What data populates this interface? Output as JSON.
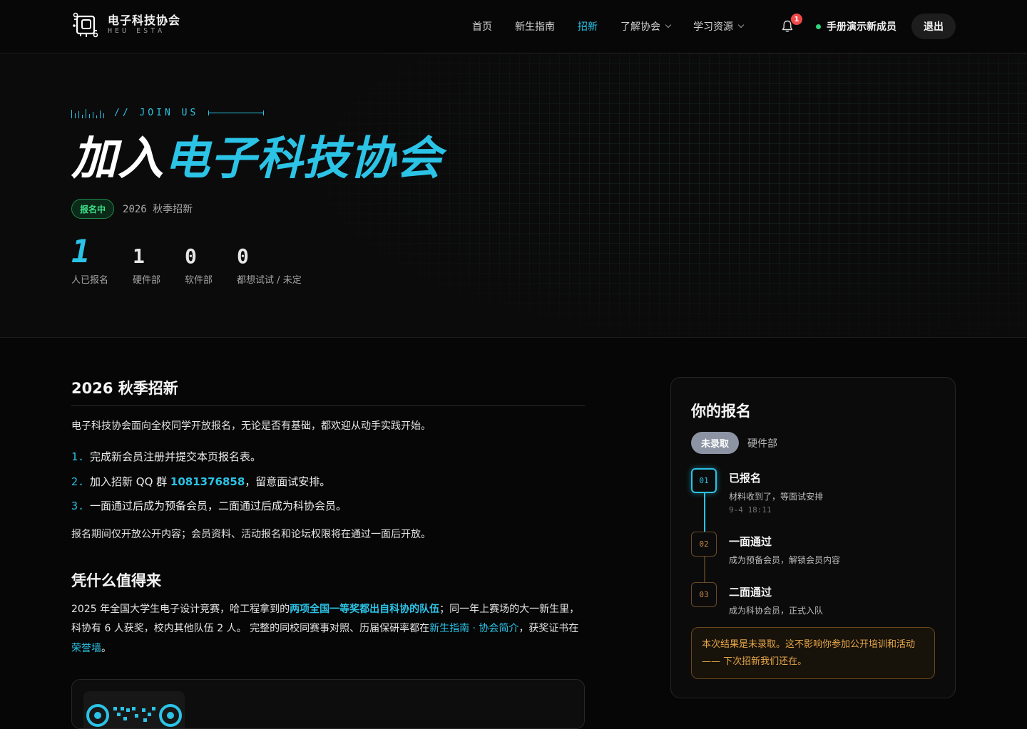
{
  "brand": {
    "name": "电子科技协会",
    "sub": "HEU ESTA"
  },
  "nav": {
    "links": [
      {
        "label": "首页",
        "active": false
      },
      {
        "label": "新生指南",
        "active": false
      },
      {
        "label": "招新",
        "active": true
      },
      {
        "label": "了解协会",
        "active": false,
        "dropdown": true
      },
      {
        "label": "学习资源",
        "active": false,
        "dropdown": true
      }
    ],
    "notification_count": "1",
    "user_name": "手册演示新成员",
    "logout_label": "退出"
  },
  "hero": {
    "eyebrow": "// JOIN US",
    "title_white": "加入",
    "title_cyan": "电子科技协会",
    "status_badge": "报名中",
    "season": "2026 秋季招新",
    "stats": [
      {
        "value": "1",
        "label": "人已报名"
      },
      {
        "value": "1",
        "label": "硬件部"
      },
      {
        "value": "0",
        "label": "软件部"
      },
      {
        "value": "0",
        "label": "都想试试 / 未定"
      }
    ]
  },
  "main": {
    "section1_title": "2026 秋季招新",
    "intro": "电子科技协会面向全校同学开放报名，无论是否有基础，都欢迎从动手实践开始。",
    "steps": [
      {
        "num": "1.",
        "text": "完成新会员注册并提交本页报名表。"
      },
      {
        "num": "2.",
        "pre": "加入招新 QQ 群 ",
        "qq": "1081376858",
        "post": "，留意面试安排。"
      },
      {
        "num": "3.",
        "text": "一面通过后成为预备会员，二面通过后成为科协会员。"
      }
    ],
    "access_note": "报名期间仅开放公开内容；会员资料、活动报名和论坛权限将在通过一面后开放。",
    "section2_title": "凭什么值得来",
    "why": {
      "t1": "2025 年全国大学生电子设计竞赛，哈工程拿到的",
      "highlight": "两项全国一等奖都出自科协的队伍",
      "t2": "；同一年上赛场的大一新生里，科协有 6 人获奖，校内其他队伍 2 人。 完整的同校同赛事对照、历届保研率都在",
      "link1": "新生指南 · 协会简介",
      "t3": "，获奖证书在",
      "link2": "荣誉墙",
      "t4": "。"
    }
  },
  "sidebar": {
    "title": "你的报名",
    "result_badge": "未录取",
    "department": "硬件部",
    "timeline": [
      {
        "num": "01",
        "title": "已报名",
        "desc": "材料收到了，等面试安排",
        "time": "9-4 18:11",
        "active": true
      },
      {
        "num": "02",
        "title": "一面通过",
        "desc": "成为预备会员，解锁会员内容",
        "active": false
      },
      {
        "num": "03",
        "title": "二面通过",
        "desc": "成为科协会员，正式入队",
        "active": false
      }
    ],
    "notice": "本次结果是未录取。这不影响你参加公开培训和活动 —— 下次招新我们还在。"
  },
  "colors": {
    "accent": "#2bc3e6",
    "success": "#3ee089",
    "warning": "#e7a84a",
    "danger": "#f04848"
  }
}
